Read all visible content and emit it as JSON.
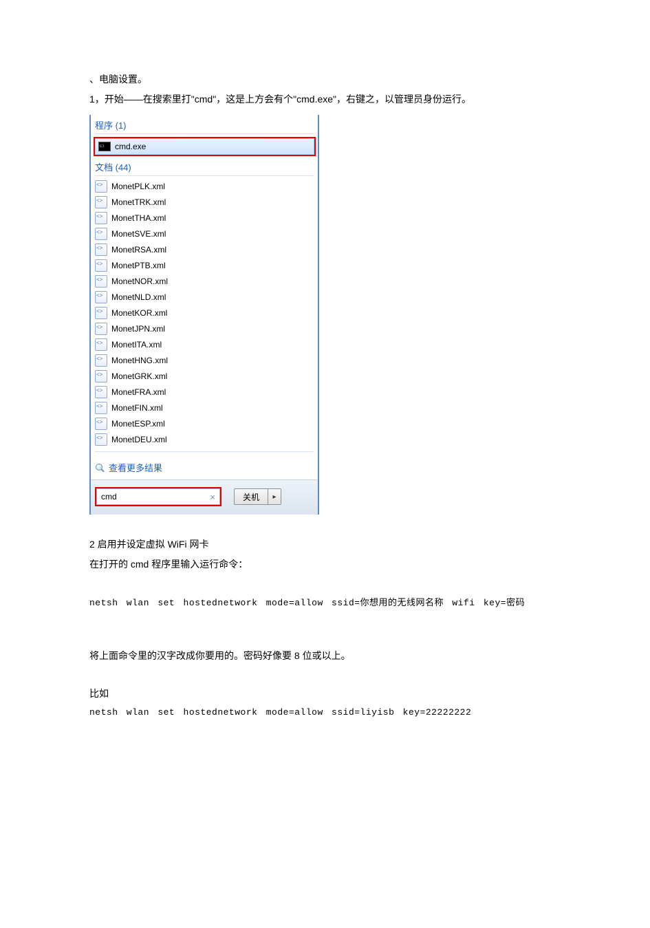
{
  "intro": {
    "line0": "、电脑设置。",
    "line1": "1，开始——在搜索里打\"cmd\"，这是上方会有个\"cmd.exe\"，右键之，以管理员身份运行。"
  },
  "startmenu": {
    "programs_header": "程序 (1)",
    "program_item": "cmd.exe",
    "documents_header": "文档 (44)",
    "documents": [
      "MonetPLK.xml",
      "MonetTRK.xml",
      "MonetTHA.xml",
      "MonetSVE.xml",
      "MonetRSA.xml",
      "MonetPTB.xml",
      "MonetNOR.xml",
      "MonetNLD.xml",
      "MonetKOR.xml",
      "MonetJPN.xml",
      "MonetITA.xml",
      "MonetHNG.xml",
      "MonetGRK.xml",
      "MonetFRA.xml",
      "MonetFIN.xml",
      "MonetESP.xml",
      "MonetDEU.xml"
    ],
    "more_results": "查看更多结果",
    "search_value": "cmd",
    "clear_symbol": "×",
    "shutdown_label": "关机",
    "shutdown_arrow": "▸"
  },
  "step2": {
    "title": "2 启用并设定虚拟 WiFi 网卡",
    "line1": "在打开的 cmd 程序里输入运行命令：",
    "cmd1": "netsh  wlan  set  hostednetwork  mode=allow  ssid=你想用的无线网名称 wifi  key=密码",
    "note": "将上面命令里的汉字改成你要用的。密码好像要 8 位或以上。",
    "example_label": "比如",
    "cmd2": "netsh  wlan  set  hostednetwork  mode=allow  ssid=liyisb  key=22222222"
  }
}
